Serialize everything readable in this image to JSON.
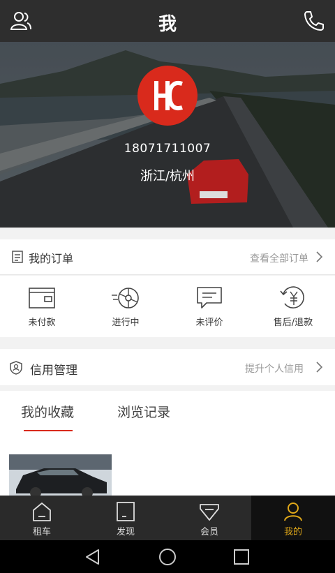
{
  "header": {
    "title": "我",
    "left_icon": "contacts-icon",
    "right_icon": "phone-icon"
  },
  "profile": {
    "logo_icon": "brand-logo-icon",
    "phone": "18071711007",
    "location": "浙江/杭州"
  },
  "orders": {
    "title": "我的订单",
    "view_all": "查看全部订单",
    "items": [
      {
        "label": "未付款",
        "icon": "wallet-icon"
      },
      {
        "label": "进行中",
        "icon": "wheel-icon"
      },
      {
        "label": "未评价",
        "icon": "comment-icon"
      },
      {
        "label": "售后/退款",
        "icon": "yen-refund-icon"
      }
    ]
  },
  "credit": {
    "title": "信用管理",
    "link": "提升个人信用"
  },
  "tabs": [
    {
      "label": "我的收藏",
      "active": true
    },
    {
      "label": "浏览记录",
      "active": false
    }
  ],
  "bottom_nav": [
    {
      "label": "租车",
      "icon": "home-icon",
      "active": false
    },
    {
      "label": "发现",
      "icon": "discover-icon",
      "active": false
    },
    {
      "label": "会员",
      "icon": "diamond-icon",
      "active": false
    },
    {
      "label": "我的",
      "icon": "person-icon",
      "active": true
    }
  ],
  "system_nav": {
    "back": "back-icon",
    "home": "home-circle-icon",
    "recent": "recent-apps-icon"
  },
  "colors": {
    "accent": "#d92a1c",
    "active_nav": "#e0a819",
    "header_bg": "#2e2e2e"
  }
}
